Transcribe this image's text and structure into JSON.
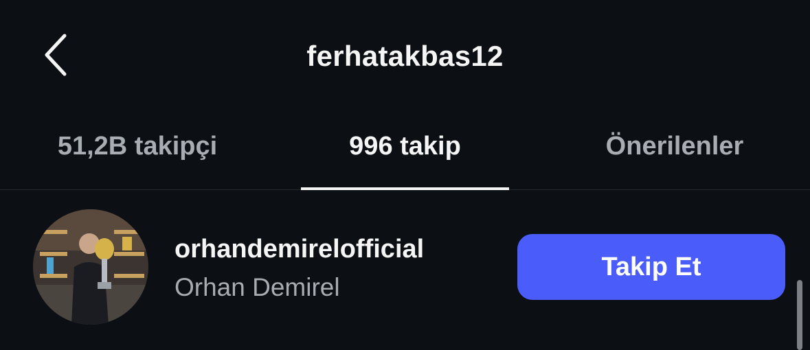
{
  "header": {
    "title": "ferhatakbas12",
    "back_icon": "chevron-left-icon"
  },
  "tabs": [
    {
      "label": "51,2B takipçi",
      "active": false
    },
    {
      "label": "996 takip",
      "active": true
    },
    {
      "label": "Önerilenler",
      "active": false
    }
  ],
  "list": {
    "items": [
      {
        "username": "orhandemirelofficial",
        "full_name": "Orhan Demirel",
        "button_label": "Takip Et"
      }
    ]
  },
  "colors": {
    "background": "#0c1014",
    "follow_button": "#4a5dfb",
    "muted_text": "#a8adb3",
    "primary_text": "#f5f5f5"
  }
}
